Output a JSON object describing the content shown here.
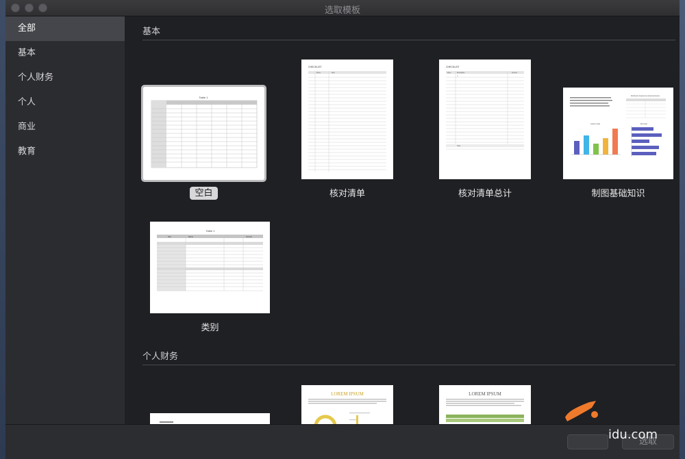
{
  "window": {
    "title": "选取模板"
  },
  "sidebar": {
    "items": [
      {
        "label": "全部",
        "active": true
      },
      {
        "label": "基本"
      },
      {
        "label": "个人财务"
      },
      {
        "label": "个人"
      },
      {
        "label": "商业"
      },
      {
        "label": "教育"
      }
    ]
  },
  "sections": [
    {
      "title": "基本"
    },
    {
      "title": "个人财务"
    }
  ],
  "templates": {
    "blank": {
      "label": "空白",
      "table_title": "Table 1"
    },
    "checklist": {
      "label": "核对清单",
      "header": "CHECKLIST",
      "col1": "Done",
      "col2": "Item"
    },
    "checklist_total": {
      "label": "核对清单总计",
      "header": "CHECKLIST",
      "col1": "Done",
      "col2": "Description",
      "col3": "Amount",
      "total": "Total"
    },
    "charting_basics": {
      "label": "制图基础知识",
      "chart1": "Column Chart",
      "chart2": "Bar Chart",
      "table_title": "Distribution Analysis by Aristocrat Factors"
    },
    "category": {
      "label": "类别",
      "table_title": "Table 1",
      "col1": "Item",
      "col2": "Name",
      "col3": "Amount"
    },
    "finance1": {
      "heading": ""
    },
    "finance2": {
      "heading": "LOREM IPSUM"
    },
    "finance3": {
      "heading": "LOREM IPSUM"
    }
  },
  "bottom": {
    "cancel_label": "",
    "choose_label": "选取"
  },
  "watermark": "idu.com",
  "colors": {
    "accent_orange": "#f07a2c",
    "bar_blue": "#5b5fbd"
  }
}
